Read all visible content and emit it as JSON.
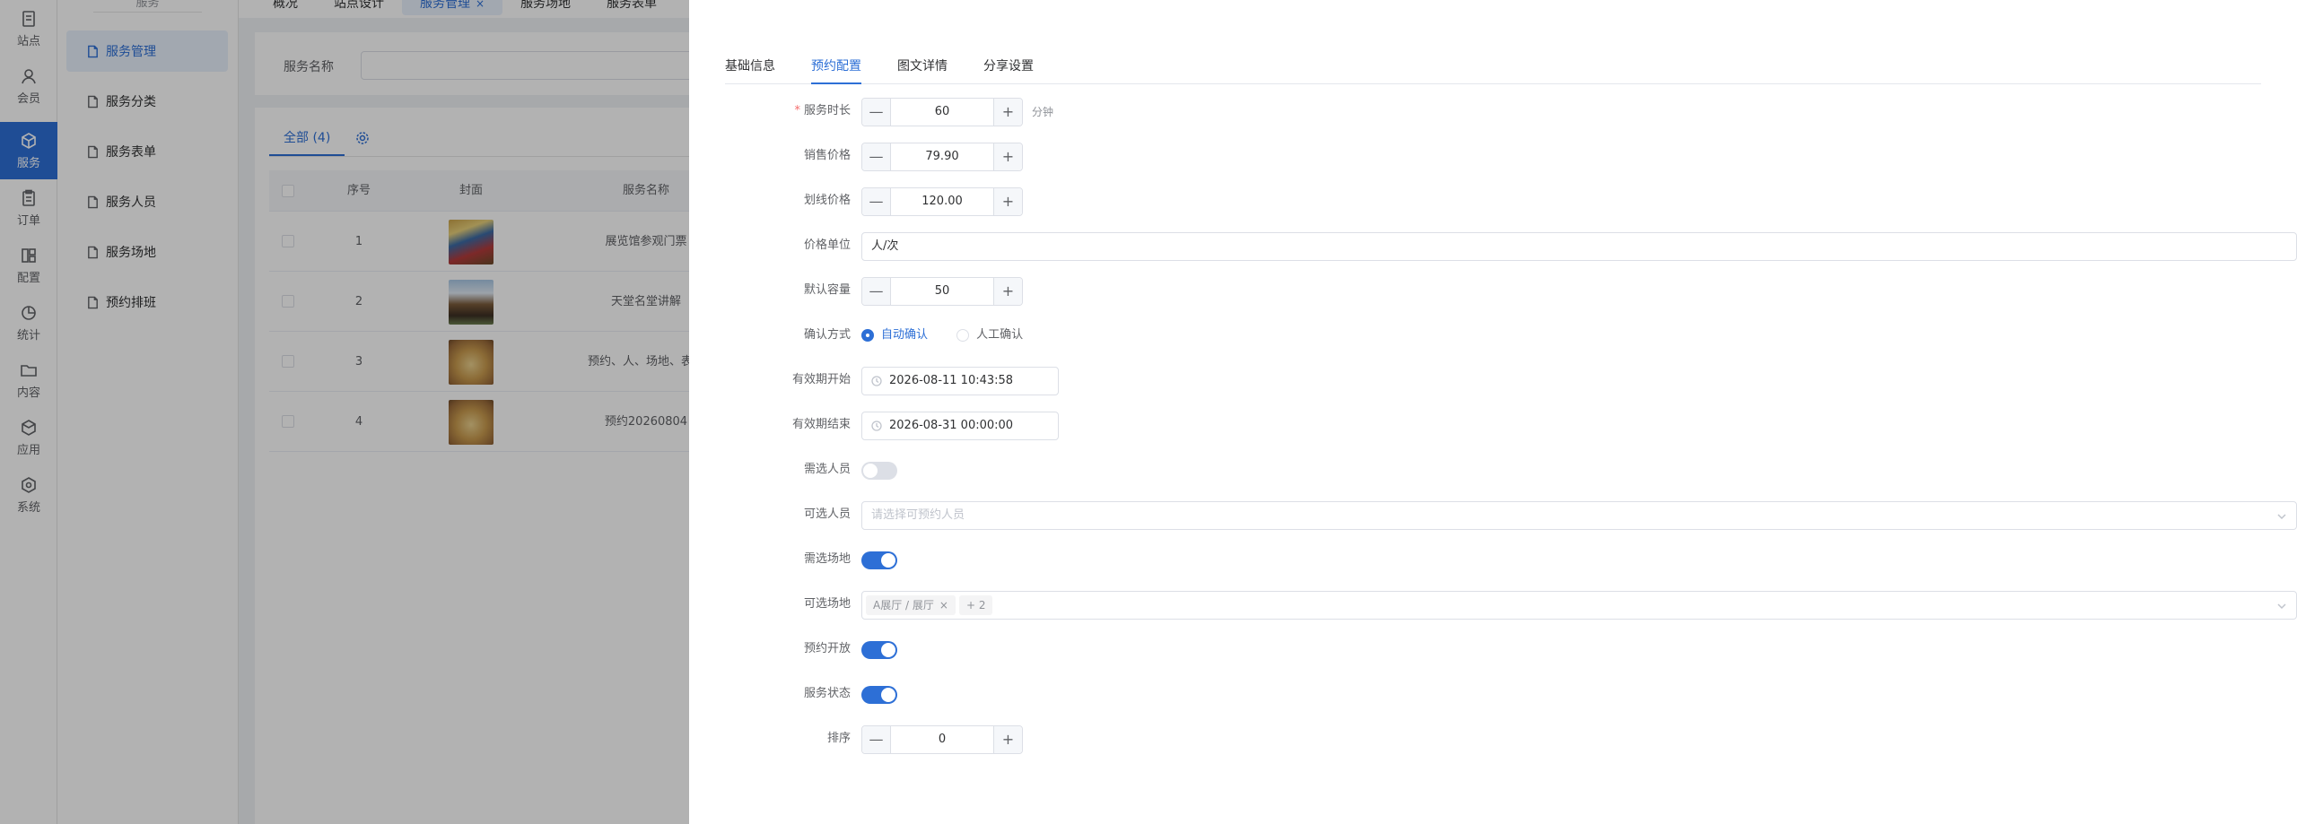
{
  "rail": [
    {
      "label": "站点",
      "icon": "site-icon"
    },
    {
      "label": "会员",
      "icon": "user-icon"
    },
    {
      "label": "服务",
      "icon": "box-icon",
      "active": true
    },
    {
      "label": "订单",
      "icon": "clipboard-icon"
    },
    {
      "label": "配置",
      "icon": "layout-icon"
    },
    {
      "label": "统计",
      "icon": "clock-chart-icon"
    },
    {
      "label": "内容",
      "icon": "folder-icon"
    },
    {
      "label": "应用",
      "icon": "cube-icon"
    },
    {
      "label": "系统",
      "icon": "hexagon-icon"
    }
  ],
  "submenu": {
    "title": "服务",
    "items": [
      "服务管理",
      "服务分类",
      "服务表单",
      "服务人员",
      "服务场地",
      "预约排班"
    ]
  },
  "tabbar": {
    "tabs": [
      "概况",
      "站点设计",
      "服务管理",
      "服务场地",
      "服务表单"
    ],
    "close_glyph": "×"
  },
  "filter": {
    "label": "服务名称",
    "value": ""
  },
  "list": {
    "tab_label": "全部 (4)",
    "headers": [
      "序号",
      "封面",
      "服务名称"
    ],
    "rows": [
      {
        "index": "1",
        "name": "展览馆参观门票"
      },
      {
        "index": "2",
        "name": "天堂名堂讲解"
      },
      {
        "index": "3",
        "name": "预约、人、场地、表单"
      },
      {
        "index": "4",
        "name": "预约20260804"
      }
    ]
  },
  "drawer": {
    "tabs": [
      "基础信息",
      "预约配置",
      "图文详情",
      "分享设置"
    ],
    "active_tab": "预约配置",
    "fields": {
      "duration": {
        "label": "服务时长",
        "required_mark": "*",
        "value": "60",
        "unit": "分钟"
      },
      "sale_price": {
        "label": "销售价格",
        "value": "79.90"
      },
      "strike_price": {
        "label": "划线价格",
        "value": "120.00"
      },
      "price_unit": {
        "label": "价格单位",
        "value": "人/次"
      },
      "capacity": {
        "label": "默认容量",
        "value": "50"
      },
      "confirm": {
        "label": "确认方式",
        "options": [
          "自动确认",
          "人工确认"
        ],
        "selected": "自动确认"
      },
      "valid_start": {
        "label": "有效期开始",
        "value": "2026-08-11 10:43:58"
      },
      "valid_end": {
        "label": "有效期结束",
        "value": "2026-08-31 00:00:00"
      },
      "need_staff": {
        "label": "需选人员",
        "on": false
      },
      "staff": {
        "label": "可选人员",
        "placeholder": "请选择可预约人员"
      },
      "need_venue": {
        "label": "需选场地",
        "on": true
      },
      "venue": {
        "label": "可选场地",
        "tags": [
          "A展厅 / 展厅"
        ],
        "more": "+ 2"
      },
      "booking_open": {
        "label": "预约开放",
        "on": true
      },
      "service_status": {
        "label": "服务状态",
        "on": true
      },
      "sort": {
        "label": "排序",
        "value": "0"
      }
    },
    "stepper_minus": "—",
    "stepper_plus": "+",
    "tag_close": "×"
  },
  "colors": {
    "accent": "#2d6fd6",
    "mask": "rgba(0,0,0,0.30)"
  }
}
